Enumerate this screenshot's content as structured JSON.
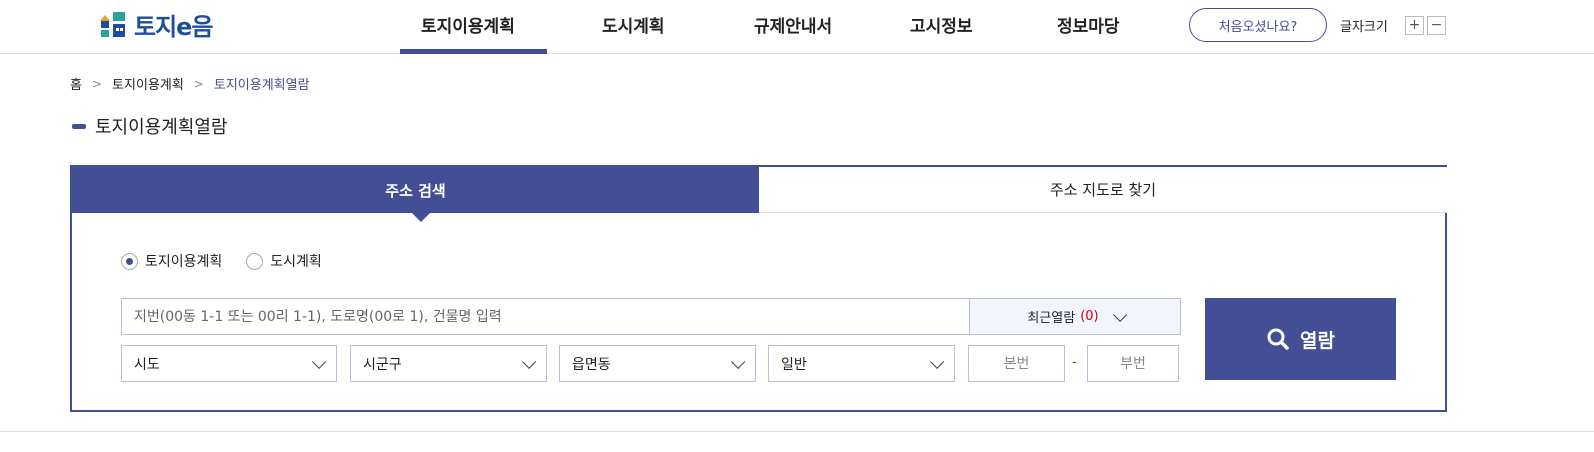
{
  "header": {
    "logo_text": "토지e음",
    "nav": [
      {
        "label": "토지이용계획",
        "active": true
      },
      {
        "label": "도시계획",
        "active": false
      },
      {
        "label": "규제안내서",
        "active": false
      },
      {
        "label": "고시정보",
        "active": false
      },
      {
        "label": "정보마당",
        "active": false
      }
    ],
    "first_visit_label": "처음오셨나요?",
    "font_size_label": "글자크기",
    "font_plus": "+",
    "font_minus": "−"
  },
  "breadcrumb": [
    "홈",
    "토지이용계획",
    "토지이용계획열람"
  ],
  "page_title": "토지이용계획열람",
  "search": {
    "tabs": [
      {
        "label": "주소 검색",
        "active": true
      },
      {
        "label": "주소 지도로 찾기",
        "active": false
      }
    ],
    "radios": [
      {
        "label": "토지이용계획",
        "checked": true
      },
      {
        "label": "도시계획",
        "checked": false
      }
    ],
    "address_placeholder": "지번(00동 1-1 또는 00리 1-1), 도로명(00로 1), 건물명 입력",
    "recent_label": "최근열람",
    "recent_count": "(0)",
    "selects": [
      "시도",
      "시군구",
      "읍면동",
      "일반"
    ],
    "main_number_placeholder": "본번",
    "dash": "-",
    "sub_number_placeholder": "부번",
    "view_button_label": "열람"
  },
  "colors": {
    "accent": "#434f95",
    "recent_count": "#d60000"
  }
}
